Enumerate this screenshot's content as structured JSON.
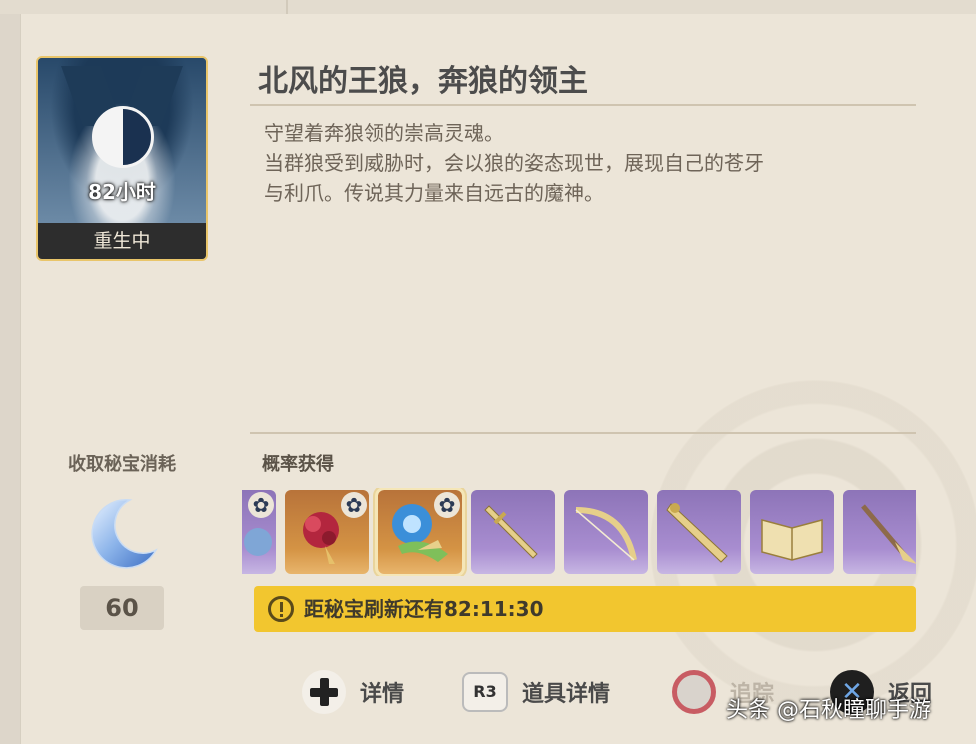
{
  "boss": {
    "timer": "82小时",
    "status": "重生中",
    "title": "北风的王狼，奔狼的领主",
    "description_line1": "守望着奔狼领的崇高灵魂。",
    "description_line2": "当群狼受到威胁时，会以狼的姿态现世，展现自己的苍牙",
    "description_line3": "与利爪。传说其力量来自远古的魔神。"
  },
  "cost": {
    "label": "收取秘宝消耗",
    "value": "60",
    "icon": "crescent-moon-resin-icon"
  },
  "drops": {
    "label": "概率获得",
    "items": [
      {
        "name": "partial-item",
        "rarity": "purple",
        "badge": true
      },
      {
        "name": "red-flower-artifact",
        "rarity": "orange",
        "badge": true
      },
      {
        "name": "blue-flower-artifact",
        "rarity": "orange",
        "badge": true,
        "selected": true
      },
      {
        "name": "sword-icon",
        "rarity": "purple"
      },
      {
        "name": "bow-icon",
        "rarity": "purple"
      },
      {
        "name": "claymore-icon",
        "rarity": "purple"
      },
      {
        "name": "catalyst-book-icon",
        "rarity": "purple"
      },
      {
        "name": "polearm-icon",
        "rarity": "purple"
      }
    ]
  },
  "refresh": {
    "text": "距秘宝刷新还有82:11:30"
  },
  "controls": {
    "details": "详情",
    "r3_key": "R3",
    "item_details": "道具详情",
    "track": "追踪",
    "back": "返回"
  },
  "watermark": "头条 @石秋瞳聊手游",
  "colors": {
    "background": "#ece5d8",
    "refresh_bar": "#f2c62f",
    "card_border": "#e9c56a",
    "purple_item": "#a88dd0",
    "orange_item": "#d49344"
  }
}
